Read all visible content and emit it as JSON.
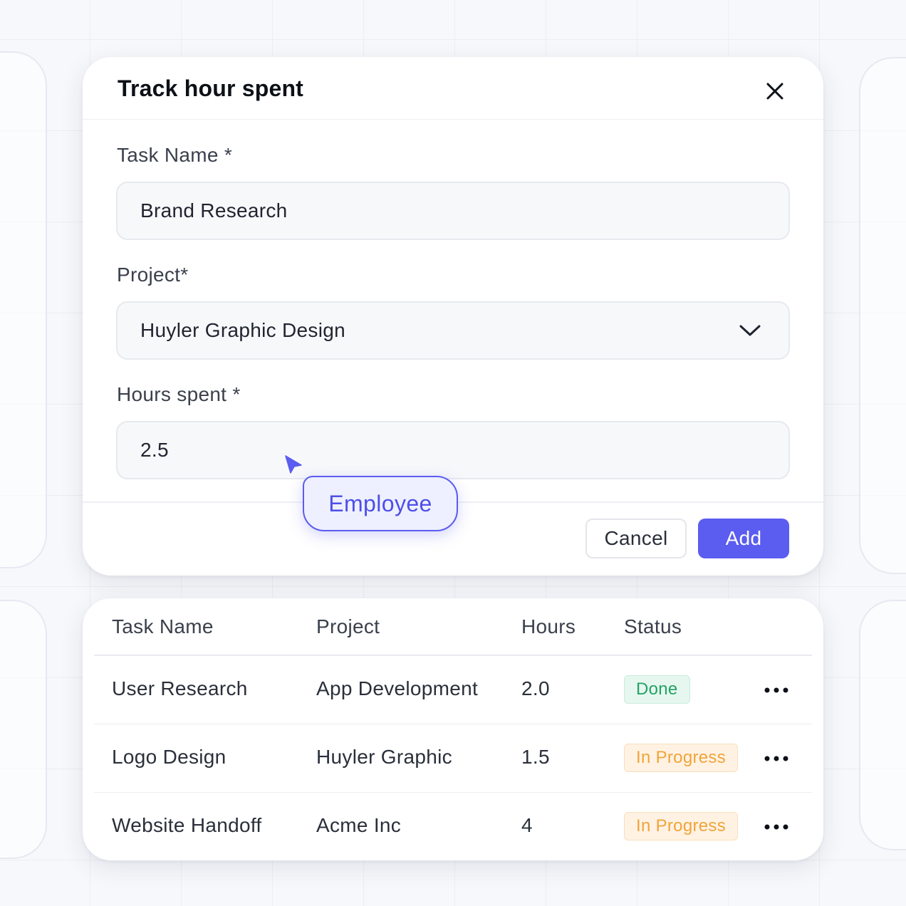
{
  "modal": {
    "title": "Track hour spent",
    "fields": {
      "task_name": {
        "label": "Task Name *",
        "value": "Brand Research"
      },
      "project": {
        "label": "Project*",
        "value": "Huyler Graphic Design"
      },
      "hours": {
        "label": "Hours spent *",
        "value": "2.5"
      }
    },
    "buttons": {
      "cancel": "Cancel",
      "add": "Add"
    }
  },
  "cursor_tag": {
    "label": "Employee"
  },
  "table": {
    "headers": [
      "Task Name",
      "Project",
      "Hours",
      "Status"
    ],
    "rows": [
      {
        "task": "User Research",
        "project": "App Development",
        "hours": "2.0",
        "status": "Done"
      },
      {
        "task": "Logo Design",
        "project": "Huyler Graphic",
        "hours": "1.5",
        "status": "In Progress"
      },
      {
        "task": "Website Handoff",
        "project": "Acme Inc",
        "hours": "4",
        "status": "In Progress"
      }
    ]
  },
  "colors": {
    "accent": "#5b5cf0",
    "done": "#23a366",
    "in_progress": "#f0a43a"
  },
  "icons": [
    "close-icon",
    "chevron-down-icon",
    "cursor-pointer-icon",
    "more-horizontal-icon"
  ]
}
